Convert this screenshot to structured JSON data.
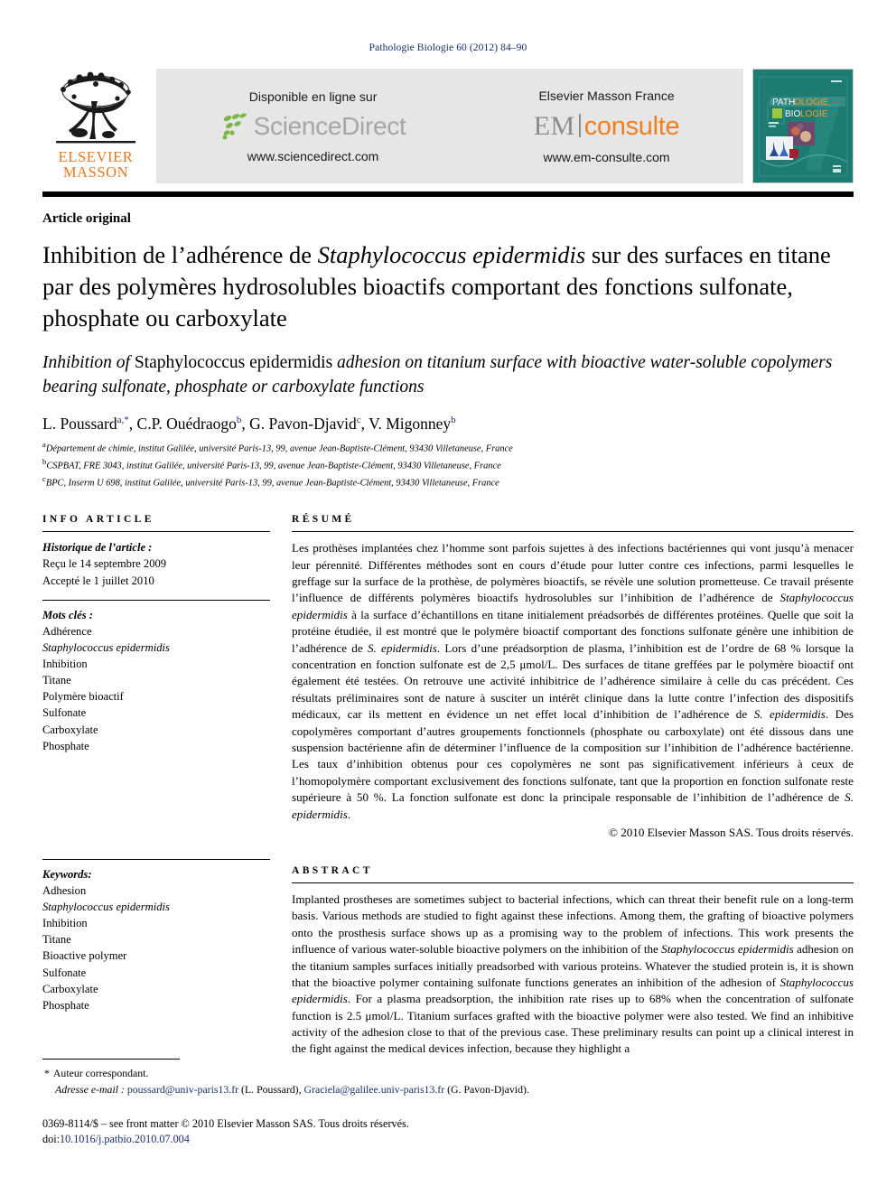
{
  "running_head": "Pathologie Biologie 60 (2012) 84–90",
  "header": {
    "publisher_logo": {
      "line1": "ELSEVIER",
      "line2": "MASSON"
    },
    "sciencedirect": {
      "available_label": "Disponible en ligne sur",
      "wordmark": "ScienceDirect",
      "url": "www.sciencedirect.com"
    },
    "emconsulte": {
      "publisher_label": "Elsevier Masson France",
      "wordmark_grey": "EM",
      "wordmark_orange": "consulte",
      "url": "www.em-consulte.com"
    },
    "cover": {
      "title_line1": "PATHOLOGIE",
      "title_line2": "BIOLOGIE"
    }
  },
  "article": {
    "type": "Article original",
    "title_fr": "Inhibition de l’adhérence de Staphylococcus epidermidis sur des surfaces en titane par des polymères hydrosolubles bioactifs comportant des fonctions sulfonate, phosphate ou carboxylate",
    "title_fr_parts": {
      "before": "Inhibition de l’adhérence de ",
      "italic": "Staphylococcus epidermidis",
      "after": " sur des surfaces en titane par des polymères hydrosolubles bioactifs comportant des fonctions sulfonate, phosphate ou carboxylate"
    },
    "title_en_parts": {
      "before": "Inhibition of ",
      "roman": "Staphylococcus epidermidis",
      "after": " adhesion on titanium surface with bioactive water-soluble copolymers bearing sulfonate, phosphate or carboxylate functions"
    },
    "authors": "L. Poussard a,*, C.P. Ouédraogo b, G. Pavon-Djavid c, V. Migonney b",
    "authors_parts": [
      {
        "name": "L. Poussard",
        "sup": "a,*",
        "sep": ", "
      },
      {
        "name": "C.P. Ouédraogo",
        "sup": "b",
        "sep": ", "
      },
      {
        "name": "G. Pavon-Djavid",
        "sup": "c",
        "sep": ", "
      },
      {
        "name": "V. Migonney",
        "sup": "b",
        "sep": ""
      }
    ],
    "affiliations": [
      {
        "mark": "a",
        "text": "Département de chimie, institut Galilée, université Paris-13, 99, avenue Jean-Baptiste-Clément, 93430 Villetaneuse, France"
      },
      {
        "mark": "b",
        "text": "CSPBAT, FRE 3043, institut Galilée, université Paris-13, 99, avenue Jean-Baptiste-Clément, 93430 Villetaneuse, France"
      },
      {
        "mark": "c",
        "text": "BPC, Inserm U 698, institut Galilée, université Paris-13, 99, avenue Jean-Baptiste-Clément, 93430 Villetaneuse, France"
      }
    ]
  },
  "info_article": {
    "heading": "INFO ARTICLE",
    "history_label": "Historique de l’article :",
    "history": [
      "Reçu le 14 septembre 2009",
      "Accepté le 1 juillet 2010"
    ],
    "keywords_label": "Mots clés :",
    "keywords": [
      "Adhérence",
      "Staphylococcus epidermidis",
      "Inhibition",
      "Titane",
      "Polymère bioactif",
      "Sulfonate",
      "Carboxylate",
      "Phosphate"
    ],
    "keywords_italic_index": 1
  },
  "keywords_en": {
    "label": "Keywords:",
    "items": [
      "Adhesion",
      "Staphylococcus epidermidis",
      "Inhibition",
      "Titane",
      "Bioactive polymer",
      "Sulfonate",
      "Carboxylate",
      "Phosphate"
    ],
    "italic_index": 1
  },
  "resume": {
    "heading": "RÉSUMÉ",
    "body_1": "Les prothèses implantées chez l’homme sont parfois sujettes à des infections bactériennes qui vont jusqu’à menacer leur pérennité. Différentes méthodes sont en cours d’étude pour lutter contre ces infections, parmi lesquelles le greffage sur la surface de la prothèse, de polymères bioactifs, se révèle une solution prometteuse. Ce travail présente l’influence de différents polymères bioactifs hydrosolubles sur l’inhibition de l’adhérence de ",
    "species_1": "Staphylococcus epidermidis",
    "body_2": " à la surface d’échantillons en titane initialement préadsorbés de différentes protéines. Quelle que soit la protéine étudiée, il est montré que le polymère bioactif comportant des fonctions sulfonate génère une inhibition de l’adhérence de ",
    "species_2": "S. epidermidis",
    "body_3": ". Lors d’une préadsorption de plasma, l’inhibition est de l’ordre de 68 % lorsque la concentration en fonction sulfonate est de 2,5 μmol/L. Des surfaces de titane greffées par le polymère bioactif ont également été testées. On retrouve une activité inhibitrice de l’adhérence similaire à celle du cas précédent. Ces résultats préliminaires sont de nature à susciter un intérêt clinique dans la lutte contre l’infection des dispositifs médicaux, car ils mettent en évidence un net effet local d’inhibition de l’adhérence de ",
    "species_3": "S. epidermidis",
    "body_4": ". Des copolymères comportant d’autres groupements fonctionnels (phosphate ou carboxylate) ont été dissous dans une suspension bactérienne afin de déterminer l’influence de la composition sur l’inhibition de l’adhérence bactérienne. Les taux d’inhibition obtenus pour ces copolymères ne sont pas significativement inférieurs à ceux de l’homopolymère comportant exclusivement des fonctions sulfonate, tant que la proportion en fonction sulfonate reste supérieure à 50 %. La fonction sulfonate est donc la principale responsable de l’inhibition de l’adhérence de ",
    "species_4": "S. epidermidis",
    "body_5": ".",
    "copyright": "© 2010 Elsevier Masson SAS. Tous droits réservés."
  },
  "abstract": {
    "heading": "ABSTRACT",
    "body_1": "Implanted prostheses are sometimes subject to bacterial infections, which can threat their benefit rule on a long-term basis. Various methods are studied to fight against these infections. Among them, the grafting of bioactive polymers onto the prosthesis surface shows up as a promising way to the problem of infections. This work presents the influence of various water-soluble bioactive polymers on the inhibition of the ",
    "species_1": "Staphylococcus epidermidis",
    "body_2": " adhesion on the titanium samples surfaces initially preadsorbed with various proteins. Whatever the studied protein is, it is shown that the bioactive polymer containing sulfonate functions generates an inhibition of the adhesion of ",
    "species_2": "Staphylococcus epidermidis",
    "body_3": ". For a plasma preadsorption, the inhibition rate rises up to 68% when the concentration of sulfonate function is 2.5 μmol/L. Titanium surfaces grafted with the bioactive polymer were also tested. We find an inhibitive activity of the adhesion close to that of the previous case. These preliminary results can point up a clinical  interest in the fight against the medical devices infection, because they highlight a"
  },
  "footer": {
    "corresponding_label": "Auteur correspondant.",
    "email_label": "Adresse e-mail :",
    "email_1": "poussard@univ-paris13.fr",
    "email_1_owner": "(L. Poussard),",
    "email_2": "Graciela@galilee.univ-paris13.fr",
    "email_2_owner": "(G. Pavon-Djavid).",
    "issn_line": "0369-8114/$ – see front matter © 2010 Elsevier Masson SAS. Tous droits réservés.",
    "doi_label": "doi:",
    "doi": "10.1016/j.patbio.2010.07.004"
  },
  "colors": {
    "link": "#1a2f6b",
    "elsevier_orange": "#e87722",
    "consulte_orange": "#f08020",
    "sciencedirect_grey": "#a6a6a6",
    "sciencedirect_green": "#7ab648",
    "band_grey": "#e6e6e6",
    "cover_teal": "#1d7b72"
  }
}
